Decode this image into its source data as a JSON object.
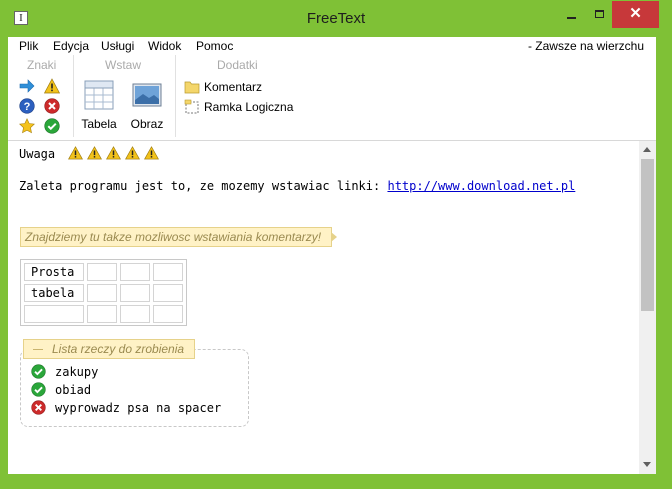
{
  "window": {
    "title": "FreeText",
    "app_icon_glyph": "I",
    "close_glyph": "✕"
  },
  "menu": {
    "items": [
      "Plik",
      "Edycja",
      "Usługi",
      "Widok",
      "Pomoc"
    ],
    "always_on_top": "- Zawsze na wierzchu"
  },
  "ribbon": {
    "groups": {
      "znaki": "Znaki",
      "wstaw": "Wstaw",
      "dodatki": "Dodatki"
    },
    "znaki_icons": [
      "arrow-right-icon",
      "warning-icon",
      "help-icon",
      "error-icon",
      "star-icon",
      "check-icon"
    ],
    "insert_table": "Tabela",
    "insert_image": "Obraz",
    "add_comment": "Komentarz",
    "add_logic_frame": "Ramka Logiczna"
  },
  "editor": {
    "line1": "Uwaga",
    "warning_count": 5,
    "line2_text": "Zaleta programu jest to, ze mozemy wstawiac linki: ",
    "line2_link": "http://www.download.net.pl",
    "comment": "Znajdziemy tu takze mozliwosc wstawiania komentarzy!",
    "table": [
      [
        "Prosta",
        "",
        "",
        ""
      ],
      [
        "tabela",
        "",
        "",
        ""
      ],
      [
        "",
        "",
        "",
        ""
      ]
    ],
    "todo": {
      "title": "Lista rzeczy do zrobienia",
      "items": [
        {
          "label": "zakupy",
          "status": "done"
        },
        {
          "label": "obiad",
          "status": "done"
        },
        {
          "label": "wyprowadz psa na spacer",
          "status": "failed"
        }
      ]
    }
  },
  "colors": {
    "frame": "#7fc136",
    "close": "#c7383a",
    "link": "#0000cc",
    "comment_bg": "#fff2c6"
  }
}
